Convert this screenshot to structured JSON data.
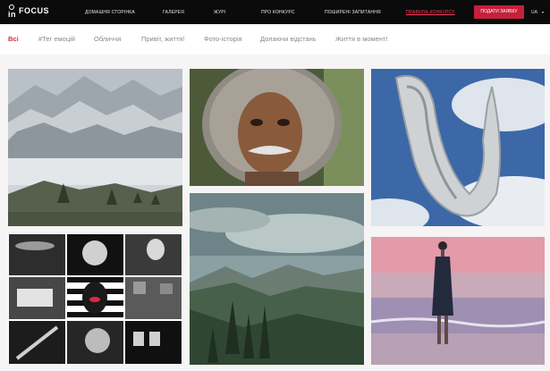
{
  "header": {
    "logo_in": "in",
    "logo_focus": "FOCUS",
    "nav": [
      {
        "label": "ДОМАШНЯ СТОРІНКА",
        "active": false
      },
      {
        "label": "ГАЛЕРЕЯ",
        "active": false
      },
      {
        "label": "ЖУРІ",
        "active": false
      },
      {
        "label": "ПРО КОНКУРС",
        "active": false
      },
      {
        "label": "ПОШИРЕНІ ЗАПИТАННЯ",
        "active": false
      },
      {
        "label": "ПРАВИЛА КОНКУРСУ",
        "active": true
      }
    ],
    "cta_label": "ПОДАТИ ЗАЯВКУ",
    "language": "UA"
  },
  "filters": [
    {
      "label": "Всі",
      "active": true
    },
    {
      "label": "#Тег емоцій",
      "active": false
    },
    {
      "label": "Обличчя",
      "active": false
    },
    {
      "label": "Привіт, життя!",
      "active": false
    },
    {
      "label": "Фото-історія",
      "active": false
    },
    {
      "label": "Долаючи відстань",
      "active": false
    },
    {
      "label": "Життя в момент!",
      "active": false
    }
  ],
  "colors": {
    "accent": "#d8294a",
    "cta": "#c6203a",
    "header_bg": "#0b0b0b"
  },
  "gallery": [
    {
      "subject": "mountain-landscape-photo"
    },
    {
      "subject": "portrait-photo"
    },
    {
      "subject": "sculpture-photo"
    },
    {
      "subject": "collage-photo-story"
    },
    {
      "subject": "valley-photo"
    },
    {
      "subject": "beach-woman-photo"
    }
  ]
}
